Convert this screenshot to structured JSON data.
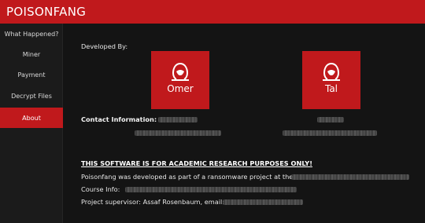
{
  "app": {
    "title": "POISONFANG"
  },
  "sidebar": {
    "items": [
      {
        "label": "What Happened?"
      },
      {
        "label": "Miner"
      },
      {
        "label": "Payment"
      },
      {
        "label": "Decrypt Files"
      },
      {
        "label": "About"
      }
    ],
    "active": "About"
  },
  "about": {
    "developed_by": "Developed By:",
    "developers": [
      {
        "name": "Omer"
      },
      {
        "name": "Tal"
      }
    ],
    "contact_label": "Contact Information:",
    "warning": "THIS SOFTWARE IS FOR ACADEMIC RESEARCH PURPOSES ONLY!",
    "developed_as": "Poisonfang was developed as part of a ransomware project at the",
    "course_info": "Course Info:",
    "supervisor": "Project supervisor: Assaf Rosenbaum, email:"
  },
  "colors": {
    "accent": "#c0191c",
    "background": "#141414",
    "sidebar": "#1b1b1b"
  },
  "icons": {
    "developer_avatar": "hooded-figure-icon"
  }
}
